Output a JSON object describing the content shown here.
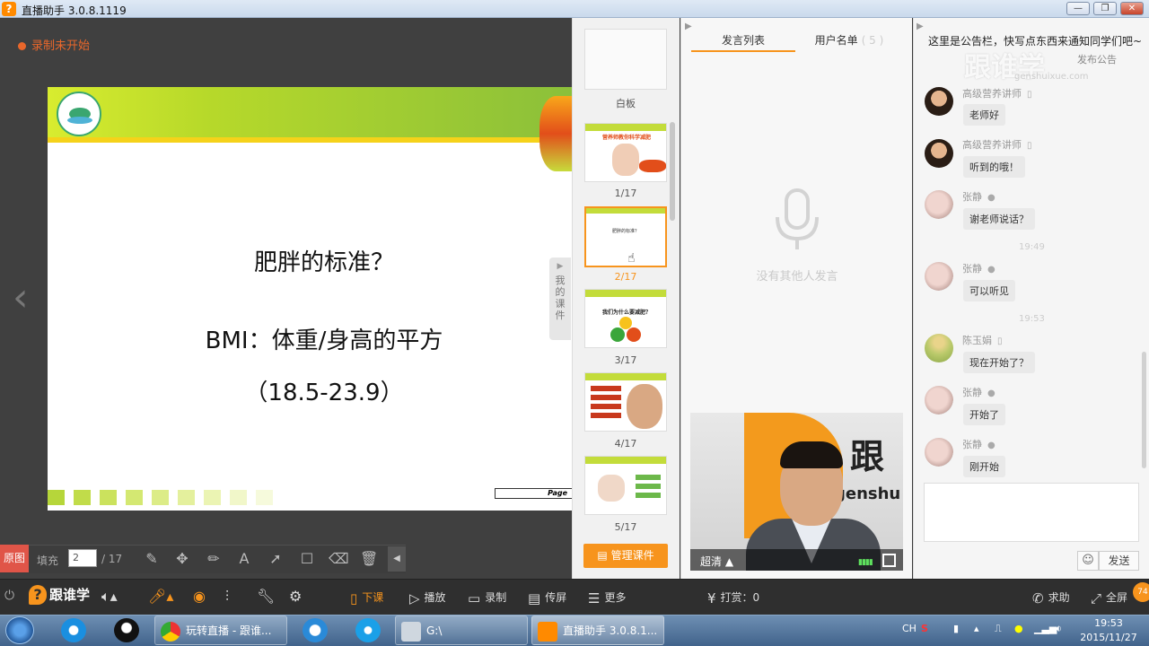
{
  "window": {
    "title": "直播助手 3.0.8.1119",
    "buttons": [
      "—",
      "❐",
      "✕"
    ]
  },
  "stage": {
    "recording": "录制未开始",
    "slide": {
      "heading": "肥胖的标准？",
      "line2": "BMI：体重/身高的平方",
      "line3": "（18.5-23.9）",
      "page_label": "Page"
    },
    "tools": {
      "original": "原图",
      "fill": "填充",
      "page_value": "2",
      "page_total": "/ 17"
    }
  },
  "thumbs": {
    "whiteboard_label": "白板",
    "items": [
      {
        "label": "1/17",
        "caption": "营养师教你科学减肥"
      },
      {
        "label": "2/17",
        "caption": "肥胖的标准？"
      },
      {
        "label": "3/17",
        "caption": "我们为什么要减肥？"
      },
      {
        "label": "4/17",
        "caption": ""
      },
      {
        "label": "5/17",
        "caption": ""
      }
    ],
    "manage_button": "管理课件",
    "mycourse_tab": "我的课件"
  },
  "speech": {
    "tab_speech": "发言列表",
    "tab_users": "用户名单",
    "user_count": "( 5 )",
    "empty_text": "没有其他人发言",
    "video_quality": "超清 ▲",
    "watermark_word": "跟",
    "watermark_sub": "genshu"
  },
  "chat": {
    "notice": "这里是公告栏，快写点东西来通知同学们吧~",
    "publish_notice": "发布公告",
    "watermark": "跟谁学",
    "watermark_sub": "genshuixue.com",
    "messages": [
      {
        "name": "高级营养讲师",
        "text": "老师好",
        "avatar": "teacher"
      },
      {
        "name": "高级营养讲师",
        "text": "听到的哦！",
        "avatar": "teacher"
      },
      {
        "name": "张静",
        "text": "谢老师说话？",
        "avatar": "girl"
      },
      {
        "time": "19:49"
      },
      {
        "name": "张静",
        "text": "可以听见",
        "avatar": "girl"
      },
      {
        "time": "19:53"
      },
      {
        "name": "陈玉娟",
        "text": "现在开始了？",
        "avatar": "field"
      },
      {
        "name": "张静",
        "text": "开始了",
        "avatar": "girl"
      },
      {
        "name": "张静",
        "text": "刚开始",
        "avatar": "girl"
      }
    ],
    "send": "发送"
  },
  "apptool": {
    "brand": "跟谁学",
    "end_class": "下课",
    "play": "播放",
    "record": "录制",
    "share": "传屏",
    "more": "更多",
    "reward": "打赏：0",
    "help": "求助",
    "fullscreen": "全屏",
    "badge": "74"
  },
  "taskbar": {
    "items": [
      {
        "label": "玩转直播 - 跟谁..."
      },
      {
        "label": "G:\\"
      },
      {
        "label": "直播助手 3.0.8.1..."
      }
    ],
    "time": "19:53",
    "date": "2015/11/27",
    "lang": "CH"
  }
}
